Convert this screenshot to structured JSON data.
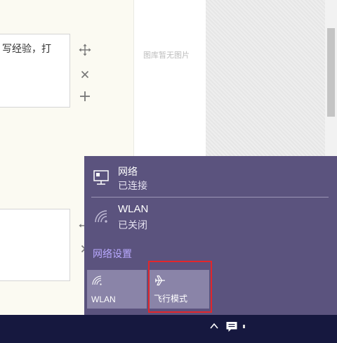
{
  "background_page": {
    "editor_text_fragment": "写经验，打",
    "gallery_empty_text": "图库暂无图片"
  },
  "network_flyout": {
    "network": {
      "title": "网络",
      "status": "已连接",
      "icon": "ethernet-icon"
    },
    "wlan": {
      "title": "WLAN",
      "status": "已关闭",
      "icon": "wifi-off-icon"
    },
    "settings_link": "网络设置",
    "quick_actions": [
      {
        "label": "WLAN",
        "icon": "wifi-icon"
      },
      {
        "label": "飞行模式",
        "icon": "airplane-icon"
      }
    ],
    "colors": {
      "flyout_bg": "#5b537e",
      "tile_bg": "#8a84a8",
      "link": "#b9a9ff",
      "highlight": "#e3262b"
    }
  },
  "taskbar": {
    "tray_icons": [
      "chevron-up-icon",
      "action-center-icon"
    ],
    "background": "#16183f"
  }
}
